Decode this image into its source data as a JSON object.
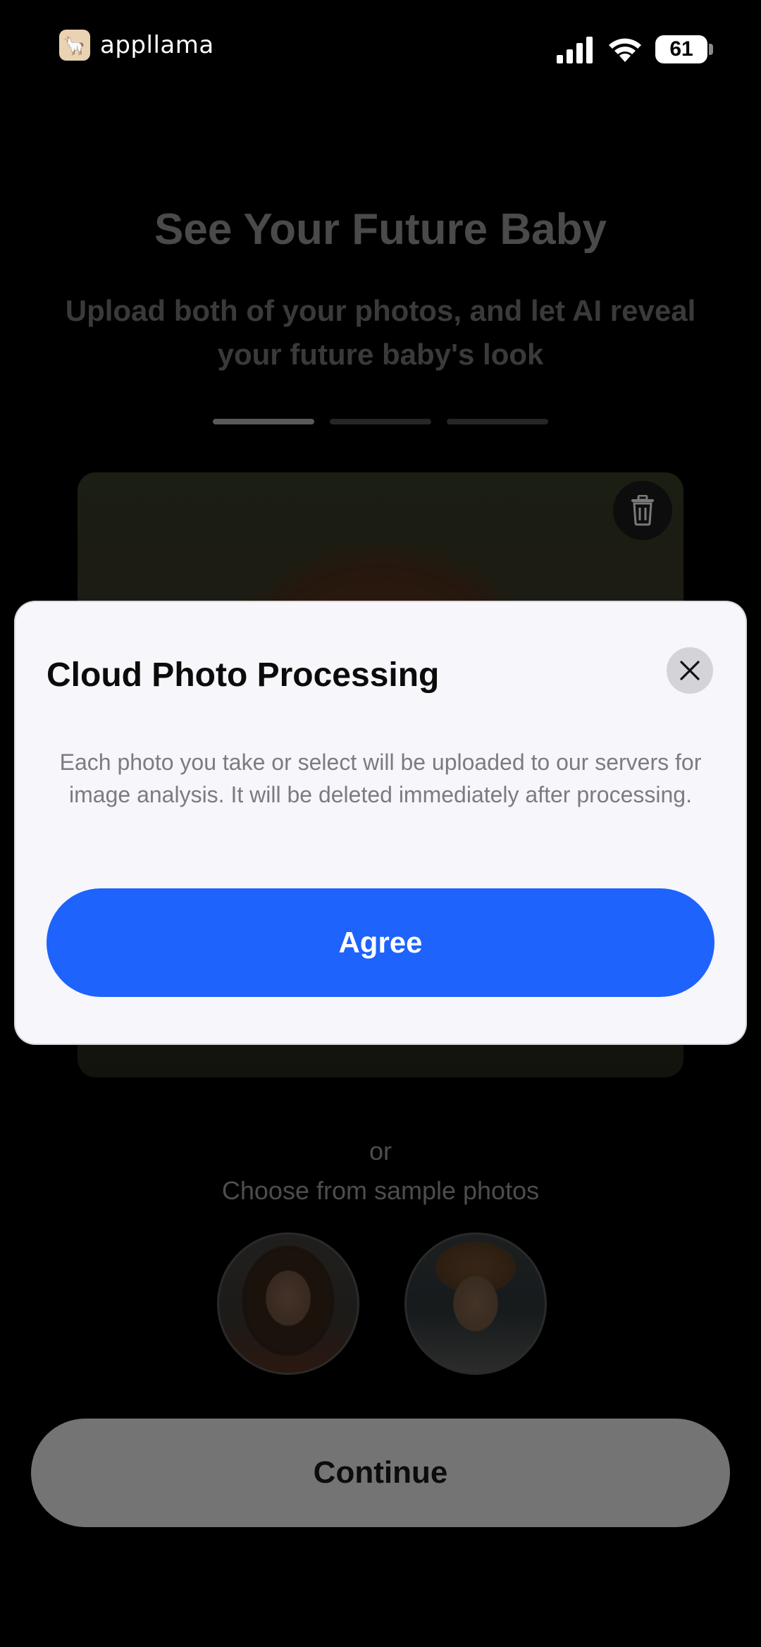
{
  "status_bar": {
    "app_name": "appllama",
    "battery": "61",
    "icons": [
      "app-logo-icon",
      "signal-icon",
      "wifi-icon",
      "battery-icon"
    ]
  },
  "page": {
    "title": "See Your Future Baby",
    "subtitle": "Upload both of your photos, and let AI reveal your future baby's look",
    "progress_steps": 3,
    "progress_current": 1,
    "photo_card": {
      "delete_icon": "trash-icon"
    },
    "or_label": "or",
    "sample_label": "Choose from sample photos",
    "samples": [
      "sample-woman",
      "sample-man"
    ],
    "continue_label": "Continue"
  },
  "modal": {
    "title": "Cloud Photo Processing",
    "body": "Each photo you take or select will be uploaded to our servers for image analysis. It will be deleted immediately after processing.",
    "agree_label": "Agree",
    "close_icon": "close-icon"
  },
  "colors": {
    "accent": "#1e63fb",
    "modal_background": "#f6f6fb",
    "page_background": "#000000",
    "continue_disabled": "#747474"
  }
}
